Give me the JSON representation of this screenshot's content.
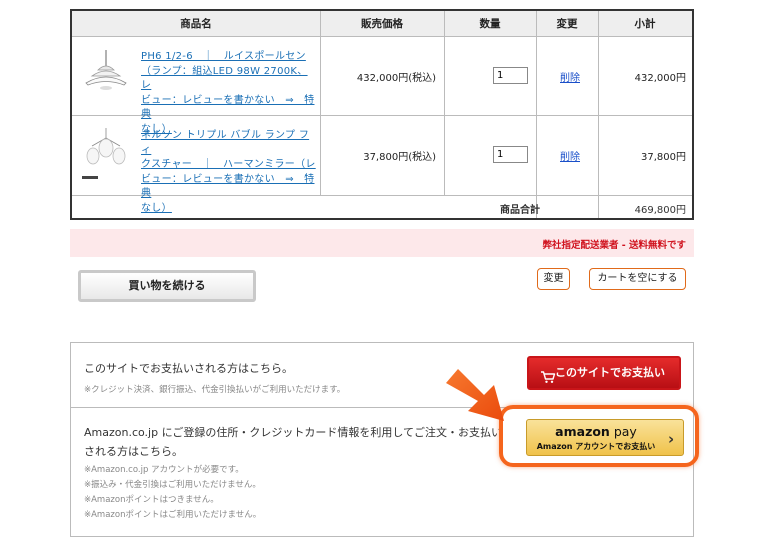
{
  "cart": {
    "headers": {
      "name": "商品名",
      "price": "販売価格",
      "qty": "数量",
      "change": "変更",
      "subtotal": "小計"
    },
    "items": [
      {
        "name_lines": [
          "PH6 1/2-6　｜　ルイスポールセン",
          "（ランプ：組込LED 98W 2700K、レ",
          "ビュー：レビューを書かない　⇒　特典",
          "なし）"
        ],
        "price": "432,000円(税込)",
        "qty": "1",
        "delete": "削除",
        "subtotal": "432,000円",
        "thumb_icon": "pendant-lamp-icon"
      },
      {
        "name_lines": [
          "ネルソン トリプル バブル ランプ フィ",
          "クスチャー　｜　ハーマンミラー（レ",
          "ビュー：レビューを書かない　⇒　特典",
          "なし）"
        ],
        "price": "37,800円(税込)",
        "qty": "1",
        "delete": "削除",
        "subtotal": "37,800円",
        "thumb_icon": "bubble-lamp-icon"
      }
    ],
    "total_label": "商品合計",
    "total_value": "469,800円"
  },
  "shipping_notice": "弊社指定配送業者 - 送料無料です",
  "buttons": {
    "continue": "買い物を続ける",
    "change": "変更",
    "empty_cart": "カートを空にする"
  },
  "payment": {
    "site": {
      "title": "このサイトでお支払いされる方はこちら。",
      "note": "※クレジット決済、銀行振込、代金引換払いがご利用いただけます。",
      "button": "このサイトでお支払い"
    },
    "amazon": {
      "title": "Amazon.co.jp にご登録の住所・クレジットカード情報を利用してご注文・お支払いされる方はこちら。",
      "notes": [
        "※Amazon.co.jp アカウントが必要です。",
        "※振込み・代金引換はご利用いただけません。",
        "※Amazonポイントはつきません。",
        "※Amazonポイントはご利用いただけません。"
      ],
      "logo_brand": "amazon",
      "logo_pay": "pay",
      "button_sub": "Amazon アカウントでお支払い"
    }
  },
  "colors": {
    "accent_orange": "#f5651d",
    "site_button_red": "#c91519",
    "link_blue": "#1a6fb5",
    "shipping_red": "#d0121e",
    "amazon_gold": "#f0c24a"
  }
}
